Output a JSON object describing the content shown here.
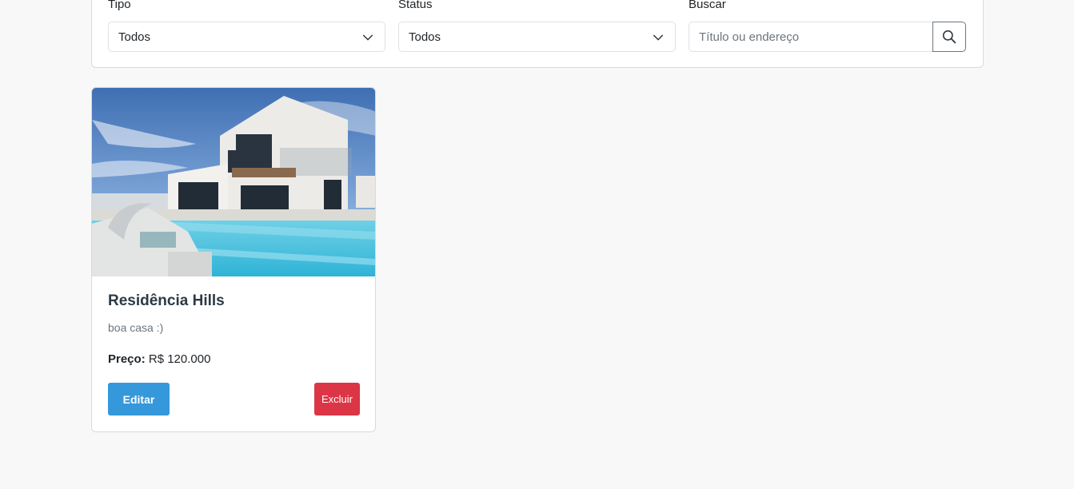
{
  "filters": {
    "tipo": {
      "label": "Tipo",
      "selected": "Todos"
    },
    "status": {
      "label": "Status",
      "selected": "Todos"
    },
    "buscar": {
      "label": "Buscar",
      "placeholder": "Título ou endereço",
      "value": ""
    }
  },
  "listings": [
    {
      "title": "Residência Hills",
      "description": "boa casa :)",
      "price_label": "Preço:",
      "price_value": "R$ 120.000",
      "edit_label": "Editar",
      "delete_label": "Excluir"
    }
  ],
  "colors": {
    "edit_button": "#3498db",
    "delete_button": "#dc3545",
    "background": "#f8f8f8"
  },
  "icons": {
    "search": "search-icon",
    "chevron": "chevron-down-icon",
    "listing_photo": "house-with-pool-photo"
  }
}
